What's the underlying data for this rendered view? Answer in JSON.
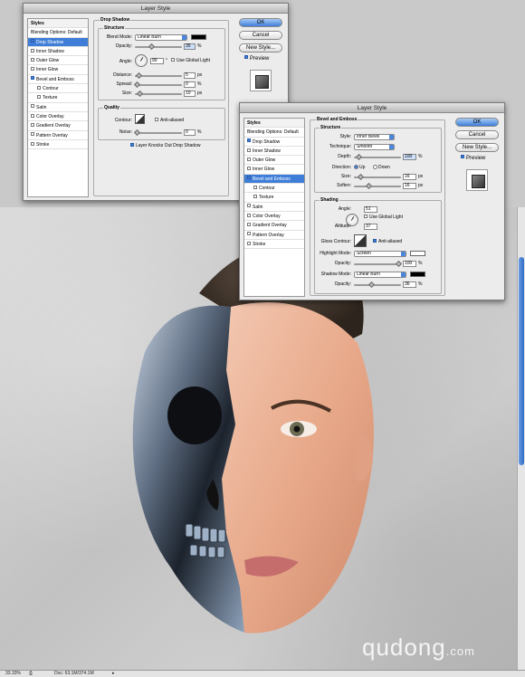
{
  "dialog1": {
    "title": "Layer Style",
    "styles_list": [
      {
        "label": "Styles",
        "checked": null,
        "selected": false,
        "sub": false,
        "header": true
      },
      {
        "label": "Blending Options: Default",
        "checked": null,
        "selected": false,
        "sub": false,
        "header": false
      },
      {
        "label": "Drop Shadow",
        "checked": true,
        "selected": true,
        "sub": false,
        "header": false
      },
      {
        "label": "Inner Shadow",
        "checked": false,
        "selected": false,
        "sub": false,
        "header": false
      },
      {
        "label": "Outer Glow",
        "checked": false,
        "selected": false,
        "sub": false,
        "header": false
      },
      {
        "label": "Inner Glow",
        "checked": false,
        "selected": false,
        "sub": false,
        "header": false
      },
      {
        "label": "Bevel and Emboss",
        "checked": true,
        "selected": false,
        "sub": false,
        "header": false
      },
      {
        "label": "Contour",
        "checked": false,
        "selected": false,
        "sub": true,
        "header": false
      },
      {
        "label": "Texture",
        "checked": false,
        "selected": false,
        "sub": true,
        "header": false
      },
      {
        "label": "Satin",
        "checked": false,
        "selected": false,
        "sub": false,
        "header": false
      },
      {
        "label": "Color Overlay",
        "checked": false,
        "selected": false,
        "sub": false,
        "header": false
      },
      {
        "label": "Gradient Overlay",
        "checked": false,
        "selected": false,
        "sub": false,
        "header": false
      },
      {
        "label": "Pattern Overlay",
        "checked": false,
        "selected": false,
        "sub": false,
        "header": false
      },
      {
        "label": "Stroke",
        "checked": false,
        "selected": false,
        "sub": false,
        "header": false
      }
    ],
    "section_title": "Drop Shadow",
    "structure_label": "Structure",
    "blend_mode_label": "Blend Mode:",
    "blend_mode_value": "Linear Burn",
    "blend_color": "#000000",
    "opacity_label": "Opacity:",
    "opacity_value": "35",
    "angle_label": "Angle:",
    "angle_value": "90",
    "use_global_light": "Use Global Light",
    "distance_label": "Distance:",
    "distance_value": "5",
    "spread_label": "Spread:",
    "spread_value": "0",
    "size_label": "Size:",
    "size_value": "10",
    "px": "px",
    "pct": "%",
    "deg": "°",
    "quality_label": "Quality",
    "contour_label": "Contour:",
    "anti_aliased": "Anti-aliased",
    "noise_label": "Noise:",
    "noise_value": "0",
    "knockout": "Layer Knocks Out Drop Shadow",
    "ok": "OK",
    "cancel": "Cancel",
    "new_style": "New Style...",
    "preview": "Preview"
  },
  "dialog2": {
    "title": "Layer Style",
    "styles_list": [
      {
        "label": "Styles",
        "checked": null,
        "selected": false,
        "sub": false,
        "header": true
      },
      {
        "label": "Blending Options: Default",
        "checked": null,
        "selected": false,
        "sub": false,
        "header": false
      },
      {
        "label": "Drop Shadow",
        "checked": true,
        "selected": false,
        "sub": false,
        "header": false
      },
      {
        "label": "Inner Shadow",
        "checked": false,
        "selected": false,
        "sub": false,
        "header": false
      },
      {
        "label": "Outer Glow",
        "checked": false,
        "selected": false,
        "sub": false,
        "header": false
      },
      {
        "label": "Inner Glow",
        "checked": false,
        "selected": false,
        "sub": false,
        "header": false
      },
      {
        "label": "Bevel and Emboss",
        "checked": true,
        "selected": true,
        "sub": false,
        "header": false
      },
      {
        "label": "Contour",
        "checked": false,
        "selected": false,
        "sub": true,
        "header": false
      },
      {
        "label": "Texture",
        "checked": false,
        "selected": false,
        "sub": true,
        "header": false
      },
      {
        "label": "Satin",
        "checked": false,
        "selected": false,
        "sub": false,
        "header": false
      },
      {
        "label": "Color Overlay",
        "checked": false,
        "selected": false,
        "sub": false,
        "header": false
      },
      {
        "label": "Gradient Overlay",
        "checked": false,
        "selected": false,
        "sub": false,
        "header": false
      },
      {
        "label": "Pattern Overlay",
        "checked": false,
        "selected": false,
        "sub": false,
        "header": false
      },
      {
        "label": "Stroke",
        "checked": false,
        "selected": false,
        "sub": false,
        "header": false
      }
    ],
    "section_title": "Bevel and Emboss",
    "structure_label": "Structure",
    "style_label": "Style:",
    "style_value": "Inner Bevel",
    "technique_label": "Technique:",
    "technique_value": "Smooth",
    "depth_label": "Depth:",
    "depth_value": "100",
    "direction_label": "Direction:",
    "dir_up": "Up",
    "dir_down": "Down",
    "size_label": "Size:",
    "size_value": "16",
    "soften_label": "Soften:",
    "soften_value": "16",
    "shading_label": "Shading",
    "angle_label": "Angle:",
    "angle_value": "51",
    "use_global_light": "Use Global Light",
    "altitude_label": "Altitude:",
    "altitude_value": "37",
    "gloss_contour_label": "Gloss Contour:",
    "anti_aliased": "Anti-aliased",
    "highlight_mode_label": "Highlight Mode:",
    "highlight_mode_value": "Screen",
    "highlight_color": "#ffffff",
    "opacity_label": "Opacity:",
    "highlight_opacity": "100",
    "shadow_mode_label": "Shadow Mode:",
    "shadow_mode_value": "Linear Burn",
    "shadow_color": "#000000",
    "shadow_opacity": "36",
    "px": "px",
    "pct": "%",
    "ok": "OK",
    "cancel": "Cancel",
    "new_style": "New Style...",
    "preview": "Preview"
  },
  "status": {
    "zoom": "33.33%",
    "doc": "Doc: 63.1M/374.1M"
  },
  "watermark": {
    "main": "qudong",
    "suffix": ".com"
  }
}
